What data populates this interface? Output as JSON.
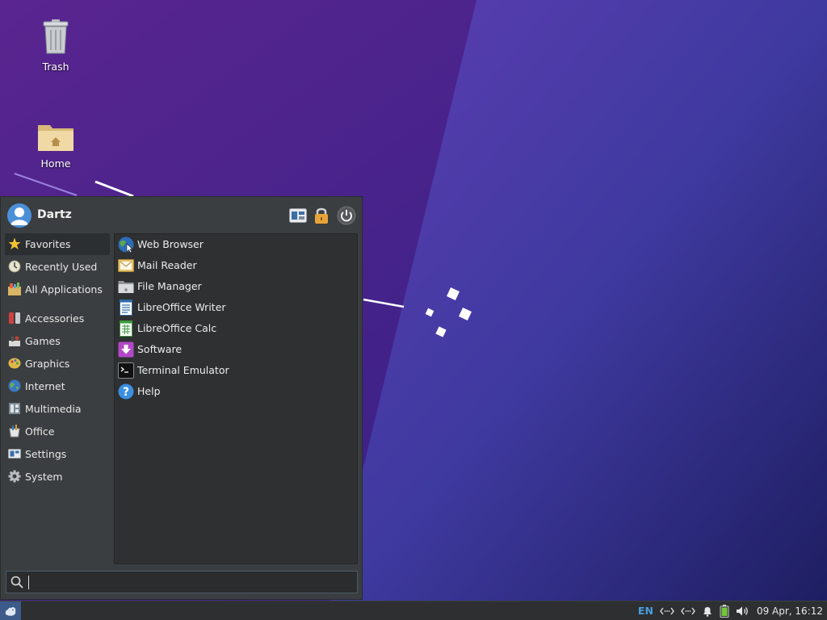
{
  "desktop": {
    "icons": [
      {
        "label": "Trash",
        "icon": "trash-icon"
      },
      {
        "label": "Home",
        "icon": "home-folder-icon"
      }
    ]
  },
  "menu": {
    "user": "Dartz",
    "header_buttons": [
      "settings-icon",
      "lock-icon",
      "power-icon"
    ],
    "categories": [
      {
        "label": "Favorites",
        "icon": "star-icon",
        "selected": true
      },
      {
        "label": "Recently Used",
        "icon": "clock-icon"
      },
      {
        "label": "All Applications",
        "icon": "applications-icon"
      },
      {
        "label": "Accessories",
        "icon": "accessories-icon"
      },
      {
        "label": "Games",
        "icon": "games-icon"
      },
      {
        "label": "Graphics",
        "icon": "graphics-icon"
      },
      {
        "label": "Internet",
        "icon": "internet-icon"
      },
      {
        "label": "Multimedia",
        "icon": "multimedia-icon"
      },
      {
        "label": "Office",
        "icon": "office-icon"
      },
      {
        "label": "Settings",
        "icon": "settings-icon"
      },
      {
        "label": "System",
        "icon": "system-gear-icon"
      }
    ],
    "apps": [
      {
        "label": "Web Browser",
        "icon": "web-browser-icon"
      },
      {
        "label": "Mail Reader",
        "icon": "mail-icon"
      },
      {
        "label": "File Manager",
        "icon": "file-manager-icon"
      },
      {
        "label": "LibreOffice Writer",
        "icon": "writer-icon"
      },
      {
        "label": "LibreOffice Calc",
        "icon": "calc-icon"
      },
      {
        "label": "Software",
        "icon": "software-icon"
      },
      {
        "label": "Terminal Emulator",
        "icon": "terminal-icon"
      },
      {
        "label": "Help",
        "icon": "help-icon"
      }
    ],
    "search": {
      "value": "",
      "placeholder": ""
    }
  },
  "panel": {
    "language": "EN",
    "clock": "09 Apr, 16:12"
  },
  "colors": {
    "wallpaper_dark": "#3a1f7a",
    "wallpaper_light": "#5b3fb0",
    "menu_bg": "#3b3e40",
    "accent": "#4a9fe0"
  }
}
